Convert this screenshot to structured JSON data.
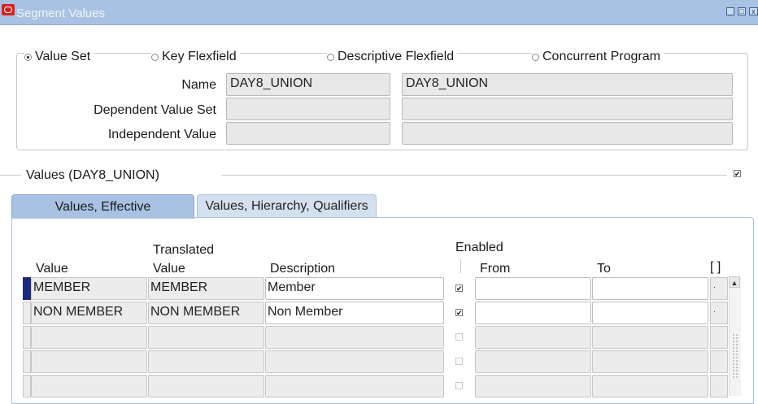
{
  "window": {
    "title": "Segment Values"
  },
  "radios": [
    {
      "label": "Value Set",
      "selected": true
    },
    {
      "label": "Key Flexfield",
      "selected": false
    },
    {
      "label": "Descriptive Flexfield",
      "selected": false
    },
    {
      "label": "Concurrent Program",
      "selected": false
    }
  ],
  "form": {
    "name_label": "Name",
    "name_value": "DAY8_UNION",
    "name_desc_value": "DAY8_UNION",
    "dependent_label": "Dependent Value Set",
    "independent_label": "Independent Value"
  },
  "section": {
    "title": "Values (DAY8_UNION)",
    "checked_mark": "✔"
  },
  "tabs": [
    {
      "label": "Values, Effective"
    },
    {
      "label": "Values, Hierarchy, Qualifiers"
    }
  ],
  "columns": {
    "value": "Value",
    "translated_top": "Translated",
    "translated_bottom": "Value",
    "description": "Description",
    "enabled": "Enabled",
    "from": "From",
    "to": "To",
    "extra": "[ ]"
  },
  "rows": [
    {
      "value": "MEMBER",
      "translated": "MEMBER",
      "description": "Member",
      "enabled": "✔",
      "extra": "."
    },
    {
      "value": "NON MEMBER",
      "translated": "NON MEMBER",
      "description": "Non Member",
      "enabled": "✔",
      "extra": "."
    },
    {
      "value": "",
      "translated": "",
      "description": "",
      "enabled": "",
      "extra": ""
    },
    {
      "value": "",
      "translated": "",
      "description": "",
      "enabled": "",
      "extra": ""
    },
    {
      "value": "",
      "translated": "",
      "description": "",
      "enabled": "",
      "extra": ""
    }
  ],
  "scroll": {
    "up_glyph": "▲"
  },
  "window_buttons": {
    "minimize": "_",
    "maximize": "□",
    "close": "x"
  }
}
